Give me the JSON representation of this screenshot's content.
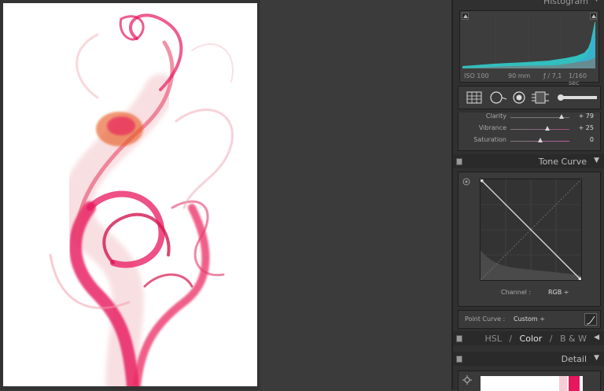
{
  "histogram": {
    "title": "Histogram",
    "iso": "ISO 100",
    "focal": "90 mm",
    "aperture": "ƒ / 7,1",
    "shutter": "1/160 sec"
  },
  "basic": {
    "sliders": [
      {
        "label": "Clarity",
        "value": "+ 79",
        "position": 0.86
      },
      {
        "label": "Vibrance",
        "value": "+ 25",
        "position": 0.62
      },
      {
        "label": "Saturation",
        "value": "0",
        "position": 0.5
      }
    ]
  },
  "tone_curve": {
    "title": "Tone Curve",
    "channel_label": "Channel :",
    "channel_value": "RGB ÷",
    "point_curve_label": "Point Curve :",
    "point_curve_value": "Custom ÷"
  },
  "hsl": {
    "hsl": "HSL",
    "sep": "/",
    "color": "Color",
    "bw": "B & W"
  },
  "detail": {
    "title": "Detail"
  },
  "colors": {
    "histogram_cyan": "#2fd6d6",
    "smoke_pink": "#e8175d",
    "smoke_orange": "#e8602a"
  }
}
